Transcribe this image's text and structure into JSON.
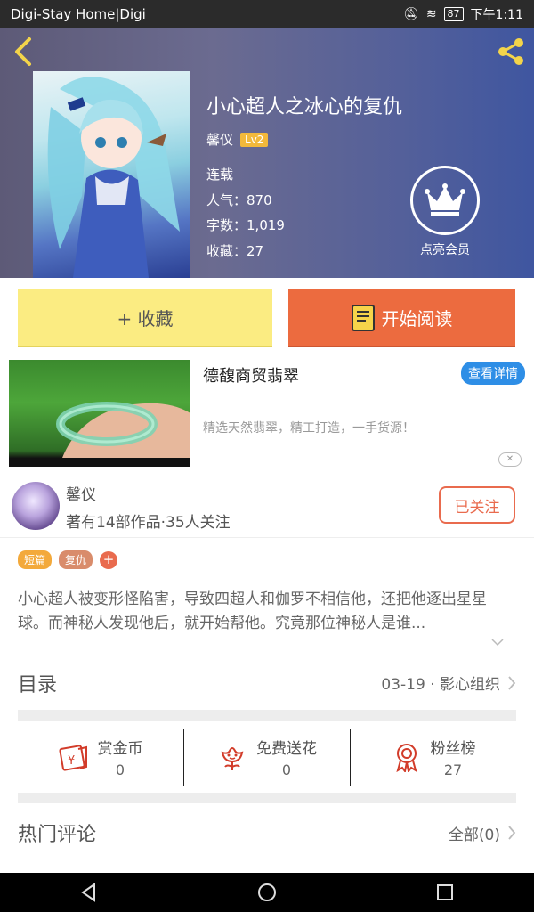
{
  "status_bar": {
    "carrier": "Digi-Stay Home|Digi",
    "battery": "87",
    "time": "下午1:11"
  },
  "book": {
    "title": "小心超人之冰心的复仇",
    "author": "馨仪",
    "level": "Lv2",
    "status": "连载",
    "popularity_label": "人气：",
    "popularity": "870",
    "words_label": "字数：",
    "words": "1,019",
    "favorites_label": "收藏：",
    "favorites": "27",
    "vip_label": "点亮会员"
  },
  "actions": {
    "collect": "+ 收藏",
    "read": "开始阅读"
  },
  "ad": {
    "title": "德馥商贸翡翠",
    "detail_button": "查看详情",
    "description": "精选天然翡翠，精工打造，一手货源！",
    "close": "✕"
  },
  "author_card": {
    "name": "馨仪",
    "info": "著有14部作品·35人关注",
    "follow": "已关注"
  },
  "tags": [
    {
      "label": "短篇",
      "color": "#f3a93b"
    },
    {
      "label": "复仇",
      "color": "#d98c6b"
    }
  ],
  "tag_add": "+",
  "description": "小心超人被变形怪陷害，导致四超人和伽罗不相信他，还把他逐出星星球。而神秘人发现他后，就开始帮他。究竟那位神秘人是谁...",
  "toc": {
    "title": "目录",
    "latest": "03-19 · 影心组织"
  },
  "stats": [
    {
      "label": "赏金币",
      "value": "0",
      "icon": "reward-coin-icon"
    },
    {
      "label": "免费送花",
      "value": "0",
      "icon": "flower-icon"
    },
    {
      "label": "粉丝榜",
      "value": "27",
      "icon": "medal-icon"
    }
  ],
  "comments": {
    "title": "热门评论",
    "all": "全部(0)"
  },
  "colors": {
    "accent_orange": "#ec6b3f",
    "collect_yellow": "#fbec82",
    "follow_red": "#e96b4e",
    "ad_blue": "#2e8ee6",
    "level_gold": "#f3b93b"
  }
}
